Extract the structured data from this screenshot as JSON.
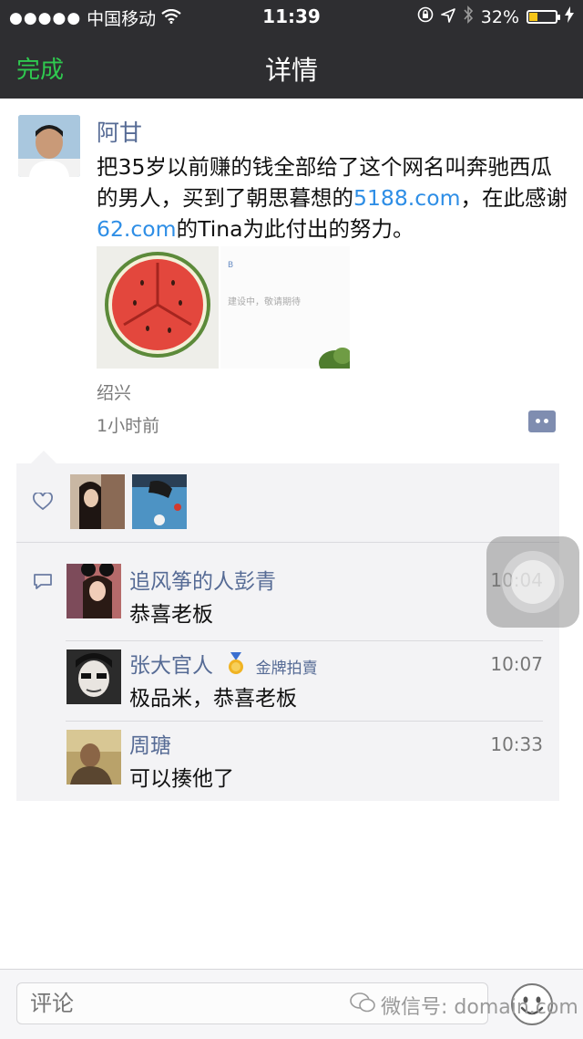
{
  "status_bar": {
    "signal_dots": "●●●●●",
    "carrier": "中国移动",
    "time": "11:39",
    "battery_percent": "32%",
    "battery_level": 0.32,
    "icons": [
      "wifi-icon",
      "lock-rotation-icon",
      "location-icon",
      "bluetooth-icon",
      "battery-icon",
      "charging-icon"
    ]
  },
  "nav": {
    "done_label": "完成",
    "title": "详情"
  },
  "post": {
    "author": "阿甘",
    "text_1": "把35岁以前赚的钱全部给了这个网名叫奔驰西瓜的男人，买到了朝思暮想的",
    "link_1": "5188.com",
    "text_2": "，在此感谢",
    "link_2": "62.com",
    "text_3": "的Tina为此付出的努力。",
    "image_2_small_text": "B",
    "image_2_text": "建设中，敬请期待",
    "location": "绍兴",
    "time_ago": "1小时前"
  },
  "comments": [
    {
      "name": "追风筝的人彭青",
      "text": "恭喜老板",
      "time": "10:04"
    },
    {
      "name": "张大官人",
      "badge_text": "金牌拍賣",
      "text": "极品米，恭喜老板",
      "time": "10:07"
    },
    {
      "name": "周瑭",
      "text": "可以揍他了",
      "time": "10:33"
    }
  ],
  "input": {
    "placeholder": "评论"
  },
  "watermark": {
    "text": "微信号: domain.com"
  },
  "colors": {
    "accent_green": "#2fc94f",
    "name_blue": "#566b95",
    "link_blue": "#2e8ee6",
    "bar_dark": "#2e2e31"
  }
}
